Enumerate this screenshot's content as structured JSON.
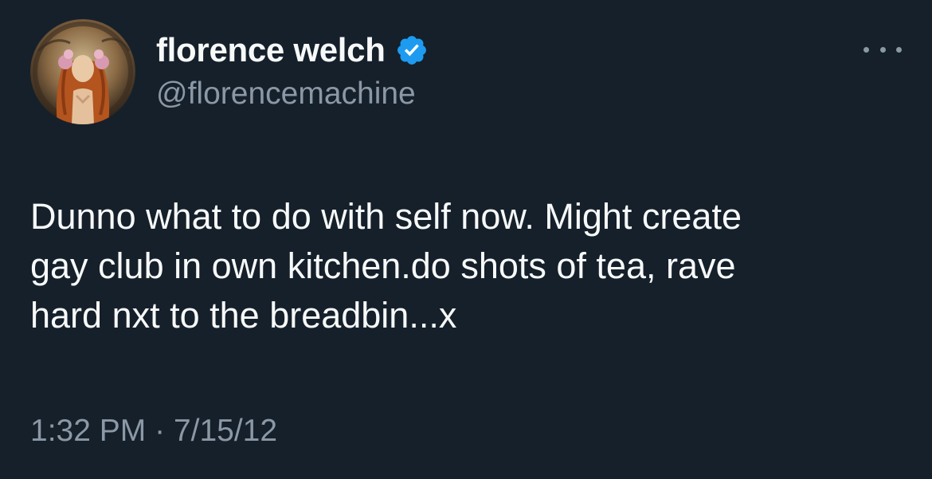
{
  "author": {
    "display_name": "florence welch",
    "handle": "@florencemachine",
    "verified": true,
    "avatar_icon": "profile-photo"
  },
  "tweet": {
    "lines": [
      "Dunno what to do with self now. Might create",
      "gay club in own kitchen.do shots of tea, rave",
      "hard nxt to the breadbin...x"
    ],
    "time": "1:32 PM",
    "separator": "·",
    "date": "7/15/12"
  },
  "colors": {
    "background": "#15202b",
    "text": "#f7f9f9",
    "secondary": "#8b98a5",
    "verified_badge": "#1d9bf0"
  }
}
